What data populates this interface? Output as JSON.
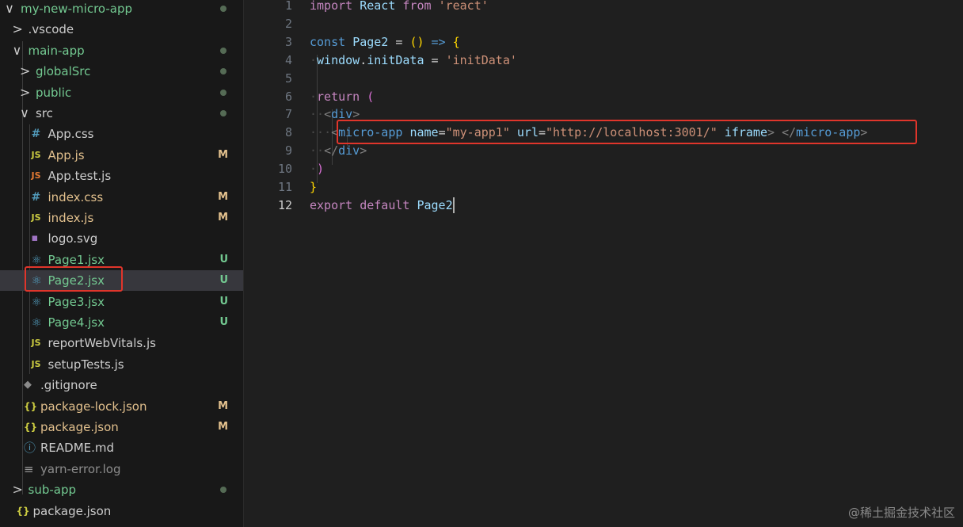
{
  "explorer": {
    "rows": [
      {
        "label": "my-new-micro-app",
        "color": "#73c991",
        "arrow": "∨",
        "icon": "",
        "badge": "",
        "dot": true
      },
      {
        "label": ".vscode",
        "color": "#cccccc",
        "arrow": ">",
        "icon": "",
        "badge": "",
        "dot": false
      },
      {
        "label": "main-app",
        "color": "#73c991",
        "arrow": "∨",
        "icon": "",
        "badge": "",
        "dot": true
      },
      {
        "label": "globalSrc",
        "color": "#73c991",
        "arrow": ">",
        "icon": "",
        "badge": "",
        "dot": true
      },
      {
        "label": "public",
        "color": "#73c991",
        "arrow": ">",
        "icon": "",
        "badge": "",
        "dot": true
      },
      {
        "label": "src",
        "color": "#cccccc",
        "arrow": "∨",
        "icon": "",
        "badge": "",
        "dot": true
      },
      {
        "label": "App.css",
        "color": "#cccccc",
        "arrow": "",
        "icon": "hash",
        "badge": "",
        "dot": false
      },
      {
        "label": "App.js",
        "color": "#e2c08d",
        "arrow": "",
        "icon": "js",
        "badge": "M",
        "dot": false
      },
      {
        "label": "App.test.js",
        "color": "#cccccc",
        "arrow": "",
        "icon": "jst",
        "badge": "",
        "dot": false
      },
      {
        "label": "index.css",
        "color": "#e2c08d",
        "arrow": "",
        "icon": "hash",
        "badge": "M",
        "dot": false
      },
      {
        "label": "index.js",
        "color": "#e2c08d",
        "arrow": "",
        "icon": "js",
        "badge": "M",
        "dot": false
      },
      {
        "label": "logo.svg",
        "color": "#cccccc",
        "arrow": "",
        "icon": "svg",
        "badge": "",
        "dot": false
      },
      {
        "label": "Page1.jsx",
        "color": "#73c991",
        "arrow": "",
        "icon": "react",
        "badge": "U",
        "dot": false
      },
      {
        "label": "Page2.jsx",
        "color": "#73c991",
        "arrow": "",
        "icon": "react",
        "badge": "U",
        "dot": false,
        "selected": true
      },
      {
        "label": "Page3.jsx",
        "color": "#73c991",
        "arrow": "",
        "icon": "react",
        "badge": "U",
        "dot": false
      },
      {
        "label": "Page4.jsx",
        "color": "#73c991",
        "arrow": "",
        "icon": "react",
        "badge": "U",
        "dot": false
      },
      {
        "label": "reportWebVitals.js",
        "color": "#cccccc",
        "arrow": "",
        "icon": "js",
        "badge": "",
        "dot": false
      },
      {
        "label": "setupTests.js",
        "color": "#cccccc",
        "arrow": "",
        "icon": "js",
        "badge": "",
        "dot": false
      },
      {
        "label": ".gitignore",
        "color": "#cccccc",
        "arrow": "",
        "icon": "git",
        "badge": "",
        "dot": false
      },
      {
        "label": "package-lock.json",
        "color": "#e2c08d",
        "arrow": "",
        "icon": "braces",
        "badge": "M",
        "dot": false
      },
      {
        "label": "package.json",
        "color": "#e2c08d",
        "arrow": "",
        "icon": "braces",
        "badge": "M",
        "dot": false
      },
      {
        "label": "README.md",
        "color": "#cccccc",
        "arrow": "",
        "icon": "info",
        "badge": "",
        "dot": false
      },
      {
        "label": "yarn-error.log",
        "color": "#8c8c8c",
        "arrow": "",
        "icon": "lines",
        "badge": "",
        "dot": false
      },
      {
        "label": "sub-app",
        "color": "#73c991",
        "arrow": ">",
        "icon": "",
        "badge": "",
        "dot": true
      },
      {
        "label": "package.json",
        "color": "#cccccc",
        "arrow": "",
        "icon": "braces",
        "badge": "",
        "dot": false
      }
    ],
    "badge_colors": {
      "M": "#e2c08d",
      "U": "#73c991"
    },
    "icon_glyphs": {
      "hash": "#",
      "js": "JS",
      "jst": "JS",
      "svg": "▪",
      "react": "⚛",
      "braces": "{}",
      "info": "ⓘ",
      "lines": "≡",
      "git": "◆"
    }
  },
  "editor": {
    "active_line": 12,
    "lines": [
      {
        "num": "1",
        "tokens": [
          [
            "import",
            "k-ctl"
          ],
          [
            " ",
            "ws"
          ],
          [
            "React",
            "k-var"
          ],
          [
            " ",
            "ws"
          ],
          [
            "from",
            "k-ctl"
          ],
          [
            " ",
            "ws"
          ],
          [
            "'react'",
            "k-str"
          ]
        ]
      },
      {
        "num": "2",
        "tokens": []
      },
      {
        "num": "3",
        "tokens": [
          [
            "const",
            "k-kw"
          ],
          [
            " ",
            "ws"
          ],
          [
            "Page2",
            "k-var"
          ],
          [
            " ",
            "ws"
          ],
          [
            "=",
            "k-white"
          ],
          [
            " ",
            "ws"
          ],
          [
            "()",
            "k-p1"
          ],
          [
            " ",
            "ws"
          ],
          [
            "=>",
            "k-kw"
          ],
          [
            " ",
            "ws"
          ],
          [
            "{",
            "k-p1"
          ]
        ]
      },
      {
        "num": "4",
        "tokens": [
          [
            "·",
            "ws"
          ],
          [
            "window",
            "k-var"
          ],
          [
            ".",
            "k-white"
          ],
          [
            "initData",
            "k-var"
          ],
          [
            " ",
            "ws"
          ],
          [
            "=",
            "k-white"
          ],
          [
            " ",
            "ws"
          ],
          [
            "'initData'",
            "k-str"
          ]
        ]
      },
      {
        "num": "5",
        "tokens": []
      },
      {
        "num": "6",
        "tokens": [
          [
            "·",
            "ws"
          ],
          [
            "return",
            "k-ctl"
          ],
          [
            " ",
            "ws"
          ],
          [
            "(",
            "k-p2"
          ]
        ]
      },
      {
        "num": "7",
        "tokens": [
          [
            "·",
            "ws"
          ],
          [
            "·",
            "ws"
          ],
          [
            "<",
            "k-br"
          ],
          [
            "div",
            "k-tag"
          ],
          [
            ">",
            "k-br"
          ]
        ]
      },
      {
        "num": "8",
        "tokens": [
          [
            "·",
            "ws"
          ],
          [
            "·",
            "ws"
          ],
          [
            "·",
            "ws"
          ],
          [
            "<",
            "k-br"
          ],
          [
            "micro-app",
            "k-tag"
          ],
          [
            " ",
            "ws"
          ],
          [
            "name",
            "k-attr"
          ],
          [
            "=",
            "k-white"
          ],
          [
            "\"my-app1\"",
            "k-str"
          ],
          [
            " ",
            "ws"
          ],
          [
            "url",
            "k-attr"
          ],
          [
            "=",
            "k-white"
          ],
          [
            "\"http://localhost:3001/\"",
            "k-str"
          ],
          [
            " ",
            "ws"
          ],
          [
            "iframe",
            "k-attr"
          ],
          [
            ">",
            "k-br"
          ],
          [
            " ",
            "ws"
          ],
          [
            "</",
            "k-br"
          ],
          [
            "micro-app",
            "k-tag"
          ],
          [
            ">",
            "k-br"
          ]
        ]
      },
      {
        "num": "9",
        "tokens": [
          [
            "·",
            "ws"
          ],
          [
            "·",
            "ws"
          ],
          [
            "</",
            "k-br"
          ],
          [
            "div",
            "k-tag"
          ],
          [
            ">",
            "k-br"
          ]
        ]
      },
      {
        "num": "10",
        "tokens": [
          [
            "·",
            "ws"
          ],
          [
            ")",
            "k-p2"
          ]
        ]
      },
      {
        "num": "11",
        "tokens": [
          [
            "}",
            "k-p1"
          ]
        ]
      },
      {
        "num": "12",
        "tokens": [
          [
            "export",
            "k-ctl"
          ],
          [
            " ",
            "ws"
          ],
          [
            "default",
            "k-ctl"
          ],
          [
            " ",
            "ws"
          ],
          [
            "Page2",
            "k-var"
          ]
        ]
      }
    ]
  },
  "watermark": "@稀土掘金技术社区"
}
